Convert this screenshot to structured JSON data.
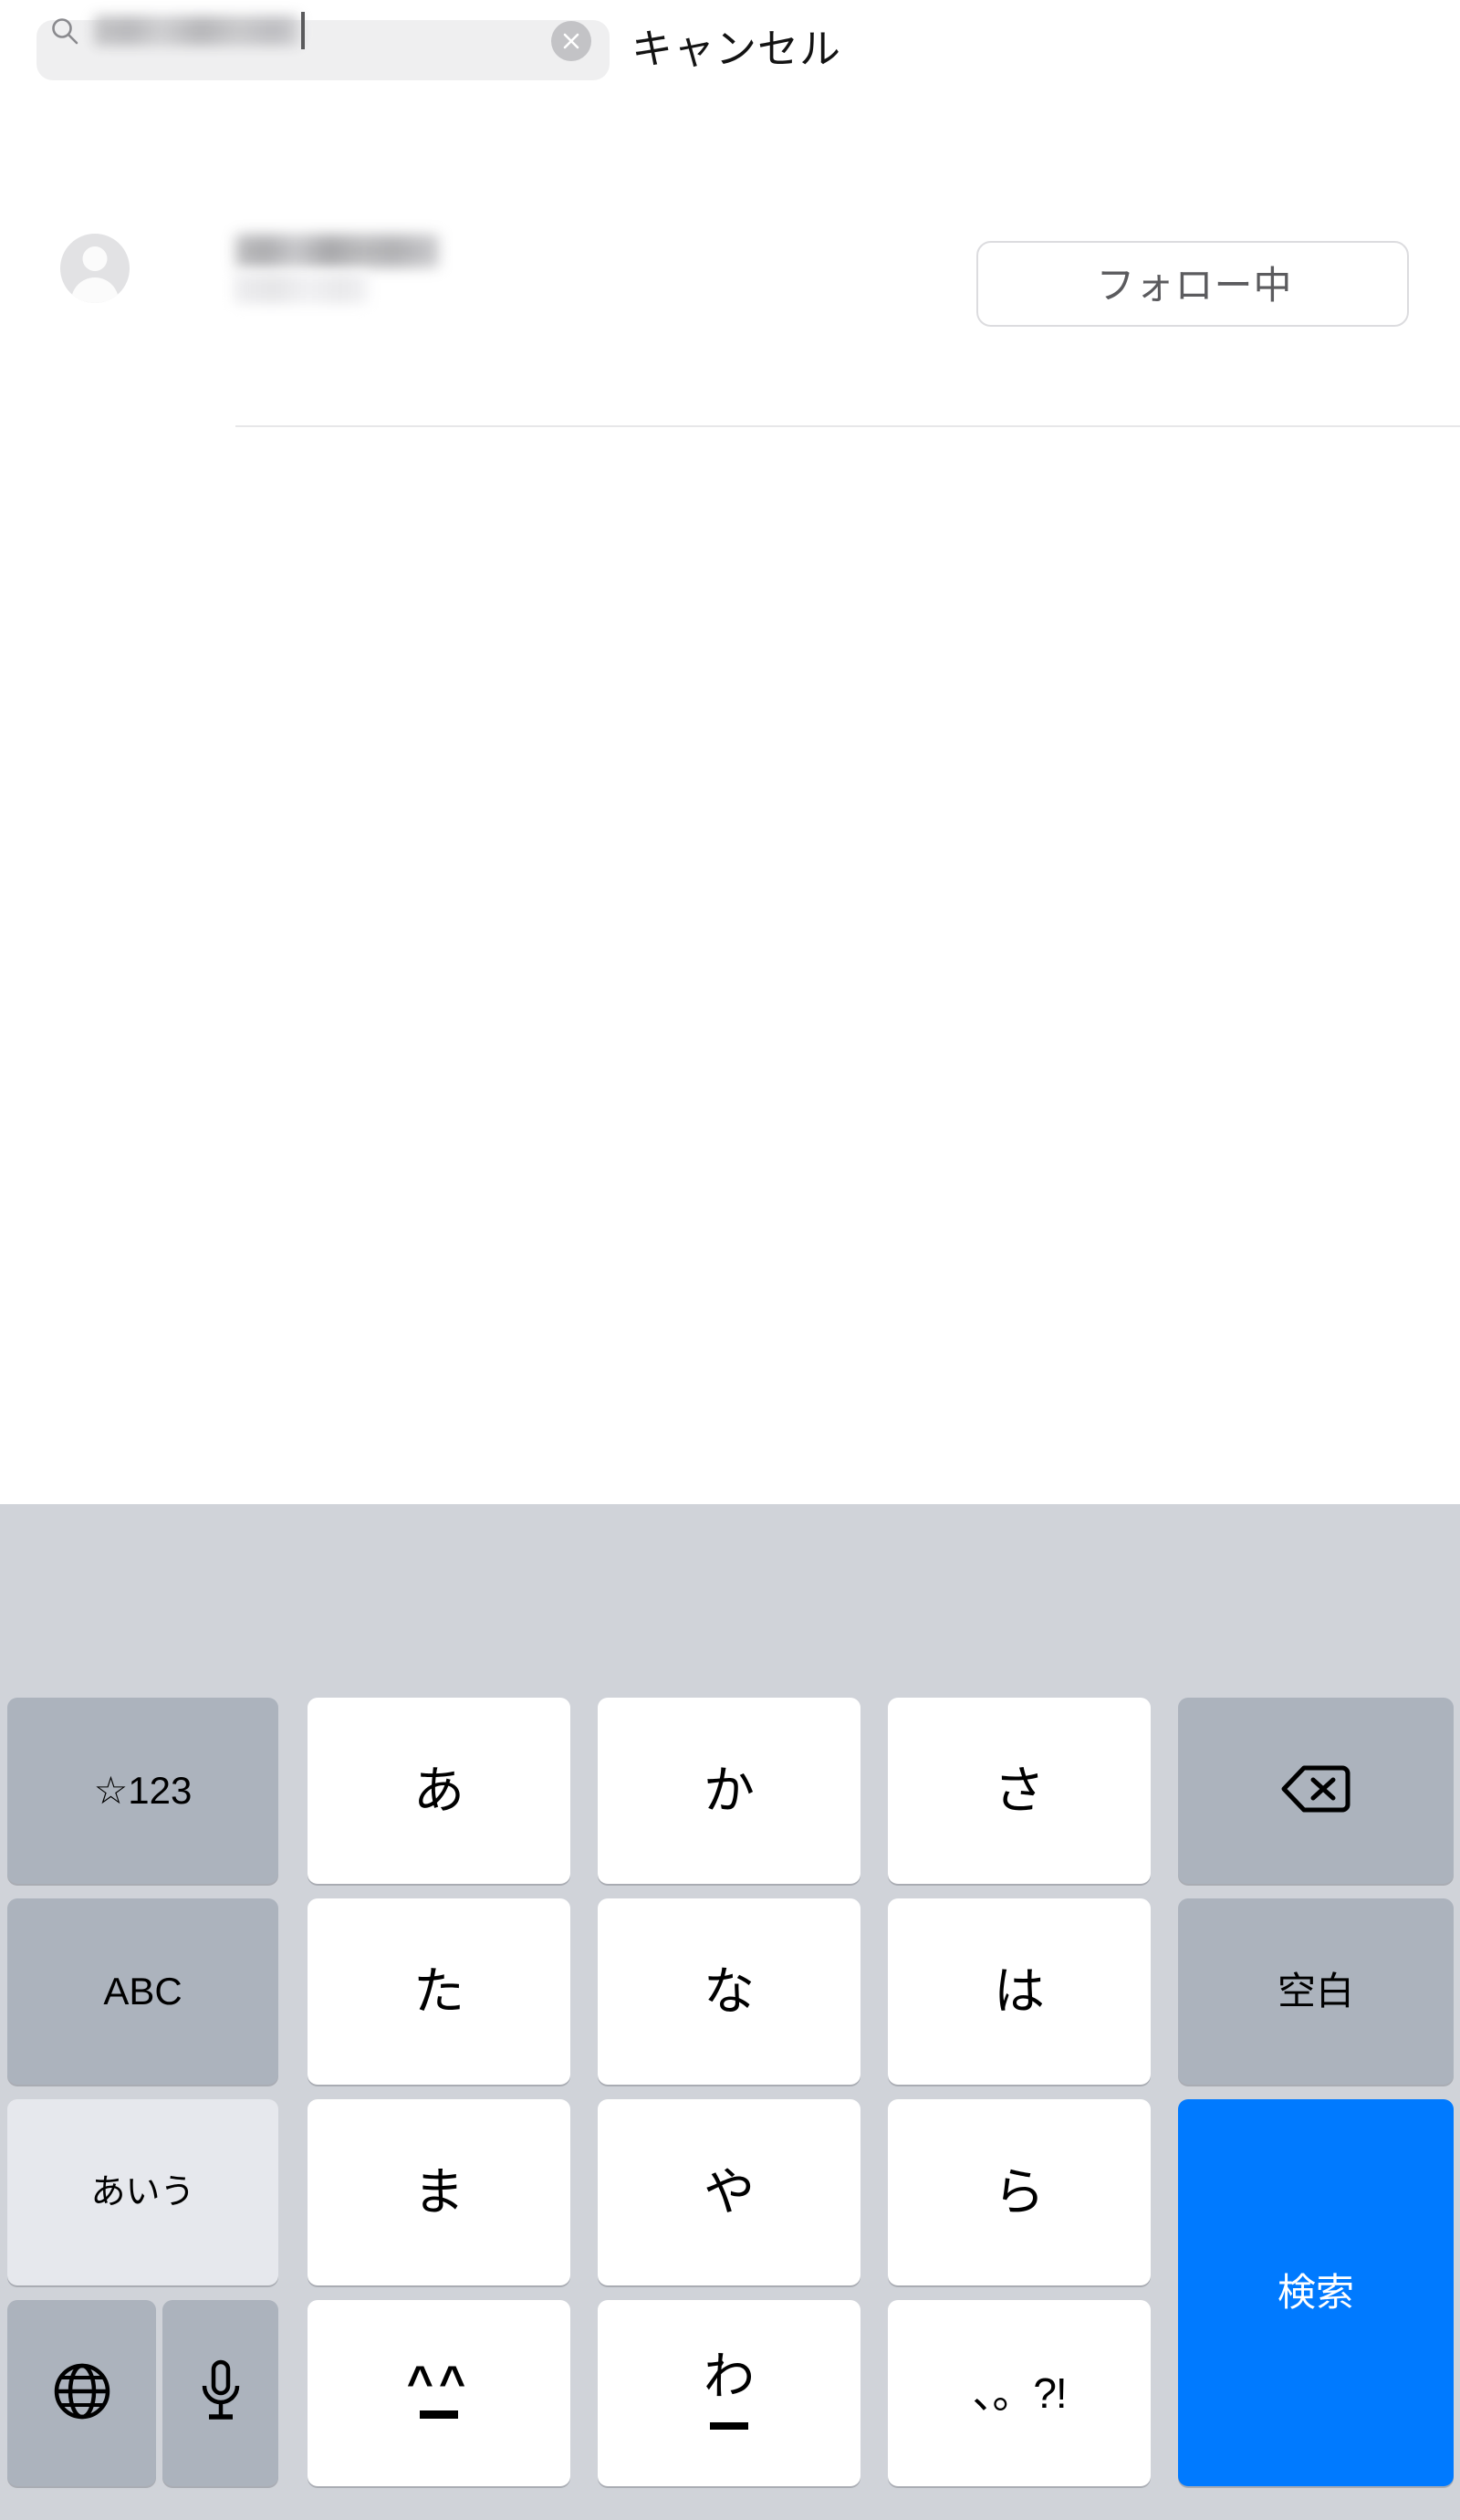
{
  "search": {
    "icon": "search-icon",
    "query_value": "",
    "query_redacted": true,
    "placeholder": "",
    "clear_icon": "clear-circle-icon",
    "cancel_label": "キャンセル"
  },
  "results": [
    {
      "avatar_icon": "default-person-avatar-icon",
      "name_redacted": true,
      "handle_redacted": true,
      "name": "",
      "handle": "",
      "action_label": "フォロー中"
    }
  ],
  "keyboard": {
    "type": "ios-japanese-kana-12key",
    "background_color": "#d0d3d9",
    "accent_color": "#007aff",
    "rows": [
      [
        {
          "name": "key-symbols-123",
          "label": "☆123",
          "style": "gray",
          "size": "sm"
        },
        {
          "name": "key-a-row",
          "label": "あ",
          "style": "white",
          "size": "lg"
        },
        {
          "name": "key-ka-row",
          "label": "か",
          "style": "white",
          "size": "lg"
        },
        {
          "name": "key-sa-row",
          "label": "さ",
          "style": "white",
          "size": "lg"
        },
        {
          "name": "key-delete",
          "label": "",
          "style": "gray",
          "icon": "delete-backspace-icon"
        }
      ],
      [
        {
          "name": "key-abc",
          "label": "ABC",
          "style": "gray",
          "size": "sm"
        },
        {
          "name": "key-ta-row",
          "label": "た",
          "style": "white",
          "size": "lg"
        },
        {
          "name": "key-na-row",
          "label": "な",
          "style": "white",
          "size": "lg"
        },
        {
          "name": "key-ha-row",
          "label": "は",
          "style": "white",
          "size": "lg"
        },
        {
          "name": "key-space",
          "label": "空白",
          "style": "gray",
          "size": "sm"
        }
      ],
      [
        {
          "name": "key-kana-mode",
          "label": "あいう",
          "style": "light",
          "size": "kana3"
        },
        {
          "name": "key-ma-row",
          "label": "ま",
          "style": "white",
          "size": "lg"
        },
        {
          "name": "key-ya-row",
          "label": "や",
          "style": "white",
          "size": "lg"
        },
        {
          "name": "key-ra-row",
          "label": "ら",
          "style": "white",
          "size": "lg"
        },
        {
          "name": "key-search-return",
          "label": "検索",
          "style": "blue",
          "size": "sm",
          "span_rows": 2
        }
      ],
      [
        {
          "name": "key-globe-language",
          "label": "",
          "style": "gray",
          "icon": "globe-icon"
        },
        {
          "name": "key-dictation",
          "label": "",
          "style": "gray",
          "icon": "microphone-icon"
        },
        {
          "name": "key-kaomoji",
          "label": "^_^",
          "style": "white",
          "icon": "kaomoji-face-icon"
        },
        {
          "name": "key-wa-row",
          "label": "わ",
          "style": "white",
          "size": "lg"
        },
        {
          "name": "key-punctuation",
          "label": "、。?!",
          "style": "white",
          "size": "punct"
        }
      ]
    ]
  }
}
